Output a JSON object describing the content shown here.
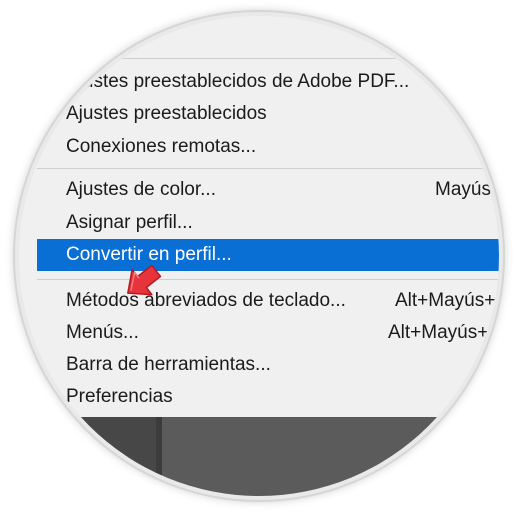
{
  "menu": {
    "items": [
      {
        "label": "Ajustes preestablecidos de Adobe PDF...",
        "shortcut": ""
      },
      {
        "label": "Ajustes preestablecidos",
        "shortcut": ""
      },
      {
        "label": "Conexiones remotas...",
        "shortcut": ""
      },
      {
        "label": "Ajustes de color...",
        "shortcut": "Mayús+"
      },
      {
        "label": "Asignar perfil...",
        "shortcut": ""
      },
      {
        "label": "Convertir en perfil...",
        "shortcut": ""
      },
      {
        "label": "Métodos abreviados de teclado...",
        "shortcut": "Alt+Mayús+C"
      },
      {
        "label": "Menús...",
        "shortcut": "Alt+Mayús+C"
      },
      {
        "label": "Barra de herramientas...",
        "shortcut": ""
      },
      {
        "label": "Preferencias",
        "shortcut": ""
      }
    ],
    "selected_index": 5
  },
  "colors": {
    "highlight": "#0a6fd4",
    "cursor": "#e8333b"
  },
  "icons": {
    "cursor": "pointer-arrow-icon"
  }
}
